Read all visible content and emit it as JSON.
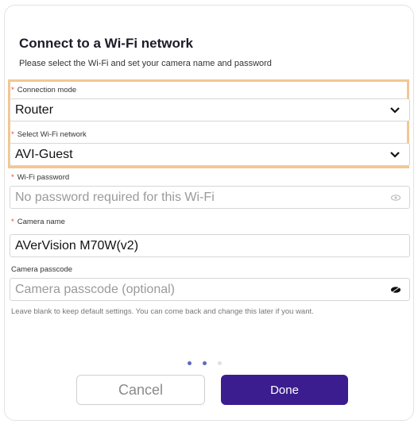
{
  "dialog": {
    "title": "Connect to a Wi-Fi network",
    "subtitle": "Please select the Wi-Fi and set your camera name and password"
  },
  "fields": {
    "connection_mode": {
      "required_mark": "*",
      "label": "Connection mode",
      "value": "Router"
    },
    "wifi_network": {
      "required_mark": "*",
      "label": "Select Wi-Fi network",
      "value": "AVI-Guest"
    },
    "wifi_password": {
      "required_mark": "*",
      "label": "Wi-Fi password",
      "placeholder": "No password required for this Wi-Fi"
    },
    "camera_name": {
      "required_mark": "*",
      "label": "Camera name",
      "value": "AVerVision M70W(v2)"
    },
    "camera_passcode": {
      "label": "Camera passcode",
      "placeholder": "Camera passcode (optional)"
    }
  },
  "help_text": "Leave blank to keep default settings. You can come back and change this later if you want.",
  "pagination": {
    "total": 3,
    "active": 2
  },
  "buttons": {
    "cancel": "Cancel",
    "done": "Done"
  },
  "colors": {
    "accent": "#3b1d8f",
    "required": "#e0443e",
    "highlight": "#f3c691"
  },
  "icons": {
    "dropdown": "chevron-down-icon",
    "password_toggle": "eye-icon"
  }
}
